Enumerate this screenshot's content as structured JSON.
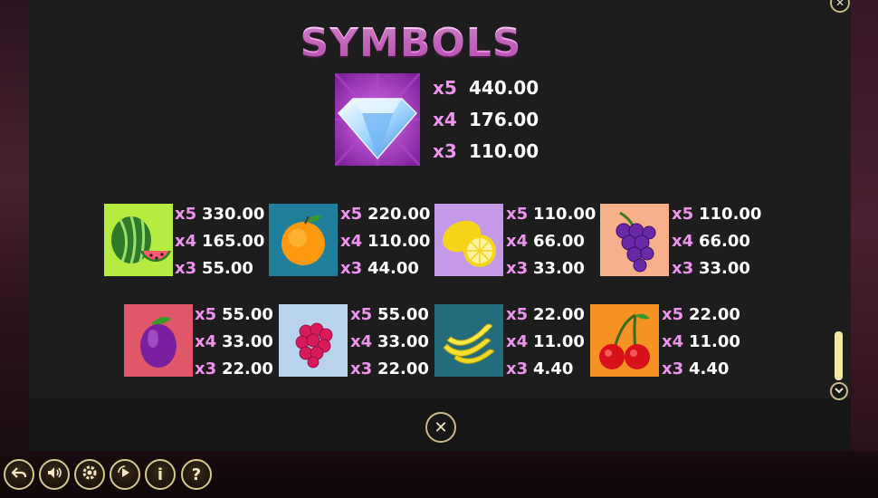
{
  "title": "SYMBOLS",
  "featured": {
    "icon": "diamond-icon",
    "payouts": [
      {
        "mult": "x5",
        "value": "440.00"
      },
      {
        "mult": "x4",
        "value": "176.00"
      },
      {
        "mult": "x3",
        "value": "110.00"
      }
    ]
  },
  "row1": [
    {
      "icon": "watermelon-icon",
      "payouts": [
        {
          "mult": "x5",
          "value": "330.00"
        },
        {
          "mult": "x4",
          "value": "165.00"
        },
        {
          "mult": "x3",
          "value": "55.00"
        }
      ]
    },
    {
      "icon": "orange-icon",
      "payouts": [
        {
          "mult": "x5",
          "value": "220.00"
        },
        {
          "mult": "x4",
          "value": "110.00"
        },
        {
          "mult": "x3",
          "value": "44.00"
        }
      ]
    },
    {
      "icon": "lemon-icon",
      "payouts": [
        {
          "mult": "x5",
          "value": "110.00"
        },
        {
          "mult": "x4",
          "value": "66.00"
        },
        {
          "mult": "x3",
          "value": "33.00"
        }
      ]
    },
    {
      "icon": "grapes-icon",
      "payouts": [
        {
          "mult": "x5",
          "value": "110.00"
        },
        {
          "mult": "x4",
          "value": "66.00"
        },
        {
          "mult": "x3",
          "value": "33.00"
        }
      ]
    }
  ],
  "row2": [
    {
      "icon": "plum-icon",
      "payouts": [
        {
          "mult": "x5",
          "value": "55.00"
        },
        {
          "mult": "x4",
          "value": "33.00"
        },
        {
          "mult": "x3",
          "value": "22.00"
        }
      ]
    },
    {
      "icon": "raspberry-icon",
      "payouts": [
        {
          "mult": "x5",
          "value": "55.00"
        },
        {
          "mult": "x4",
          "value": "33.00"
        },
        {
          "mult": "x3",
          "value": "22.00"
        }
      ]
    },
    {
      "icon": "banana-icon",
      "payouts": [
        {
          "mult": "x5",
          "value": "22.00"
        },
        {
          "mult": "x4",
          "value": "11.00"
        },
        {
          "mult": "x3",
          "value": "4.40"
        }
      ]
    },
    {
      "icon": "cherry-icon",
      "payouts": [
        {
          "mult": "x5",
          "value": "22.00"
        },
        {
          "mult": "x4",
          "value": "11.00"
        },
        {
          "mult": "x3",
          "value": "4.40"
        }
      ]
    }
  ],
  "controls": {
    "close_glyph": "✕",
    "info_glyph": "i",
    "help_glyph": "?"
  },
  "toolbar_icons": [
    "back-icon",
    "sound-icon",
    "settings-icon",
    "autoplay-icon",
    "info-icon",
    "help-icon"
  ],
  "colors": {
    "multiplier": "#ee93ee",
    "value": "#ffffff",
    "button_border": "#c9b98a",
    "title_pink": "#f59ef0"
  }
}
